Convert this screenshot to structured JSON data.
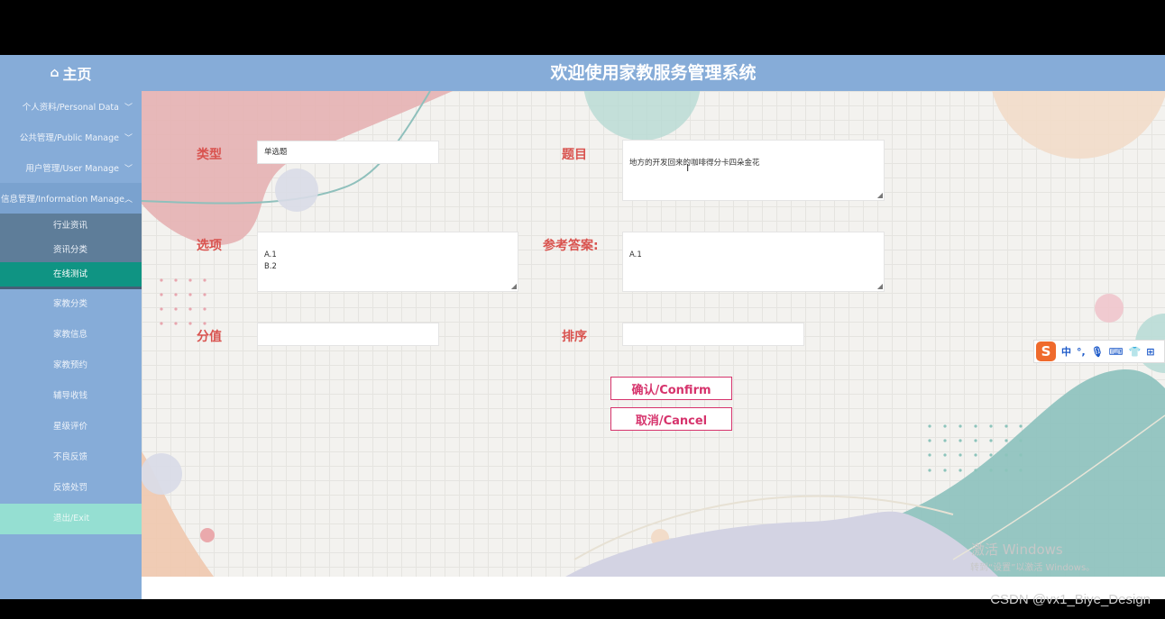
{
  "header": {
    "home_label": "主页",
    "home_icon": "home-icon",
    "title": "欢迎使用家教服务管理系统"
  },
  "sidebar": {
    "groups": [
      {
        "label": "个人资料/Personal Data"
      },
      {
        "label": "公共管理/Public Manage"
      },
      {
        "label": "用户管理/User Manage"
      },
      {
        "label": "信息管理/Information Manage"
      }
    ],
    "sub_items": [
      {
        "label": "行业资讯"
      },
      {
        "label": "资讯分类"
      },
      {
        "label": "在线测试"
      }
    ],
    "items": [
      {
        "label": "家教分类"
      },
      {
        "label": "家教信息"
      },
      {
        "label": "家教预约"
      },
      {
        "label": "辅导收钱"
      },
      {
        "label": "星级评价"
      },
      {
        "label": "不良反馈"
      },
      {
        "label": "反馈处罚"
      },
      {
        "label": "退出/Exit"
      }
    ]
  },
  "form": {
    "type_label": "类型",
    "type_value": "单选题",
    "question_label": "题目",
    "question_value": "地方的开发回来的咖啡得分卡四朵金花",
    "options_label": "选项",
    "options_value": "A.1\nB.2",
    "answer_label": "参考答案:",
    "answer_value": "A.1",
    "score_label": "分值",
    "score_value": "",
    "order_label": "排序",
    "order_value": "",
    "confirm_label": "确认/Confirm",
    "cancel_label": "取消/Cancel"
  },
  "ime": {
    "logo": "S",
    "mode": "中",
    "punct": "°,",
    "icons": [
      "microphone-icon",
      "keyboard-icon",
      "shirt-icon",
      "grid-icon"
    ]
  },
  "watermark": {
    "line1": "激活 Windows",
    "line2": "转到“设置”以激活 Windows。",
    "csdn": "CSDN @vx1_Biye_Design"
  },
  "colors": {
    "header_bg": "#86acd8",
    "active_item": "#0f9483",
    "exit_bg": "#95dfd2",
    "label_red": "#d9534f",
    "button_pink": "#d6336c"
  }
}
